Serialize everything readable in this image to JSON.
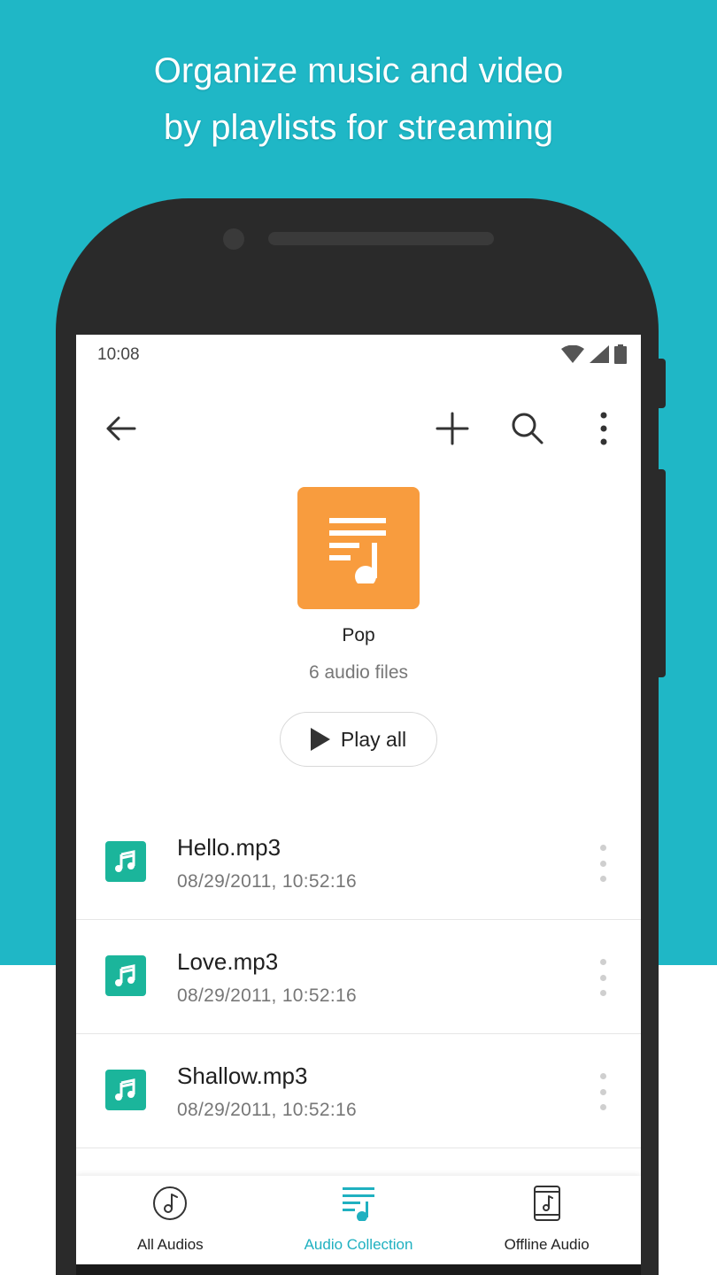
{
  "headline": {
    "line1": "Organize music and video",
    "line2": "by playlists for streaming"
  },
  "status_bar": {
    "time": "10:08",
    "icons": [
      "wifi-icon",
      "signal-icon",
      "battery-icon"
    ]
  },
  "toolbar": {
    "icons": [
      "back-arrow-icon",
      "plus-icon",
      "search-icon",
      "more-vertical-icon"
    ]
  },
  "playlist": {
    "name": "Pop",
    "count_label": "6 audio files",
    "play_all_label": "Play all",
    "cover_icon": "playlist-music-icon",
    "cover_color": "#f89c3e"
  },
  "files": [
    {
      "name": "Hello.mp3",
      "date": "08/29/2011, 10:52:16"
    },
    {
      "name": "Love.mp3",
      "date": "08/29/2011, 10:52:16"
    },
    {
      "name": "Shallow.mp3",
      "date": "08/29/2011, 10:52:16"
    }
  ],
  "bottom_nav": {
    "items": [
      {
        "label": "All Audios",
        "icon": "music-note-circle-icon",
        "active": false
      },
      {
        "label": "Audio Collection",
        "icon": "playlist-music-icon",
        "active": true
      },
      {
        "label": "Offline Audio",
        "icon": "phone-music-icon",
        "active": false
      }
    ]
  },
  "colors": {
    "background_teal": "#1fb7c6",
    "accent": "#1fb0c0",
    "file_icon": "#1bb59b"
  }
}
